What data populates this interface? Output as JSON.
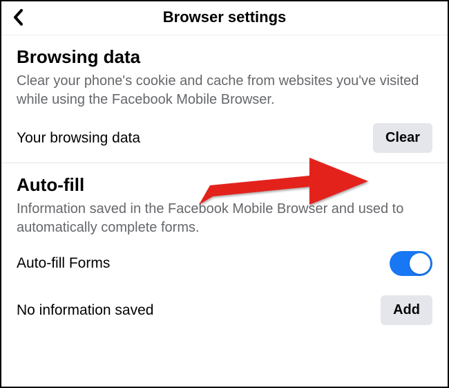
{
  "header": {
    "title": "Browser settings"
  },
  "browsing_data": {
    "section_title": "Browsing data",
    "description": "Clear your phone's cookie and cache from websites you've visited while using the Facebook Mobile Browser.",
    "row_label": "Your browsing data",
    "clear_button": "Clear"
  },
  "auto_fill": {
    "section_title": "Auto-fill",
    "description": "Information saved in the Facebook Mobile Browser and used to automatically complete forms.",
    "forms_label": "Auto-fill Forms",
    "forms_toggle": true,
    "no_info_label": "No information saved",
    "add_button": "Add"
  }
}
